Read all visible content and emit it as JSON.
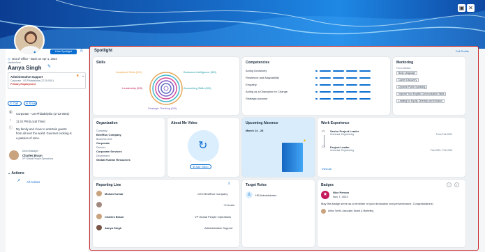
{
  "header": {
    "icons": [
      "image-icon",
      "close-icon"
    ]
  },
  "profile": {
    "status": "Out of Office - Back on Apr 1, 2024",
    "pronoun": "she/her/hers",
    "name": "Aanya Singh",
    "hide_spotlight": "Hide Spotlight",
    "job_title": "Administrative Support",
    "job_sub": "Corporate - US-Philadelphia (1713-0001)",
    "primary": "Primary Employment",
    "call": "Call",
    "email": "Email",
    "location": "Corporate - US-Philadelphia (1713-0001)",
    "time": "11:41 PM (Local Time)",
    "bio": [
      "My family and I love to entertain guests",
      "from all over the world. Gourmet cooking is",
      "a passion of mine."
    ],
    "manager_label": "Direct Manager",
    "manager_name": "Charles Braun",
    "manager_title": "VP Global People Operations",
    "actions_title": "Actions",
    "all_actions": "All Actions"
  },
  "spotlight": {
    "title": "Spotlight",
    "full_profile": "Full Profile"
  },
  "skills": {
    "title": "Skills",
    "labels": [
      "Analytical Skills (5/5)",
      "Business Intelligence (5/5)",
      "Leadership (5/5)",
      "Accounting Skills (5/5)",
      "Strategic Thinking (5/5)"
    ]
  },
  "competencies": {
    "title": "Competencies",
    "items": [
      {
        "name": "Acting Decisively",
        "level": 1
      },
      {
        "name": "Resilience and Adaptability",
        "level": 1
      },
      {
        "name": "Empathy",
        "level": 1
      },
      {
        "name": "Acting as a Champion for Change",
        "level": 1
      },
      {
        "name": "Strategic purpose",
        "level": 1
      }
    ]
  },
  "mentoring": {
    "title": "Mentoring",
    "sub": "I'm a mentor:",
    "tags": [
      "Body Language",
      "Career Discovery",
      "Dynamic Public Speaking",
      "Improve Your English Communication Skills",
      "Leading for Equity, Diversity and Inclusion"
    ]
  },
  "organization": {
    "title": "Organization",
    "company_label": "Company:",
    "company": "BestRun Company",
    "bu_label": "Business Unit:",
    "bu": "Corporate",
    "division_label": "Division:",
    "division": "Corporate Services",
    "dept_label": "Department:",
    "dept": "Global Human Resources"
  },
  "about": {
    "title": "About Me Video",
    "add": "Add Video"
  },
  "absence": {
    "title": "Upcoming Absence",
    "dates": "March 14 - 28"
  },
  "work": {
    "title": "Work Experience",
    "items": [
      {
        "role": "Senior Project Leader",
        "org": "Universal, Engineering",
        "dates": "From Feb 2021"
      },
      {
        "role": "Project Leader",
        "org": "Universal, Engineering",
        "dates": "Feb 2020 - Feb 2021"
      }
    ],
    "view_all": "View All"
  },
  "reporting": {
    "title": "Reporting Line",
    "rows": [
      {
        "name": "Mohan Kumar",
        "title": "CEO BestRun Company"
      },
      {
        "name": "",
        "title": "+2 levels"
      },
      {
        "name": "Charles Braun",
        "title": "VP Global People Operations"
      },
      {
        "name": "Aanya Singh",
        "title": "Administrative Support"
      }
    ]
  },
  "roles": {
    "title": "Target Roles",
    "role": "HR Administrator"
  },
  "badges": {
    "title": "Badges",
    "name": "Nice Person",
    "date": "Nov 7, 2023",
    "message": "May this badge serve as a reminder of your dedication and perseverance. Congratulations!",
    "giver": "Arthur Smith, Associate, Brand & Marketing"
  }
}
